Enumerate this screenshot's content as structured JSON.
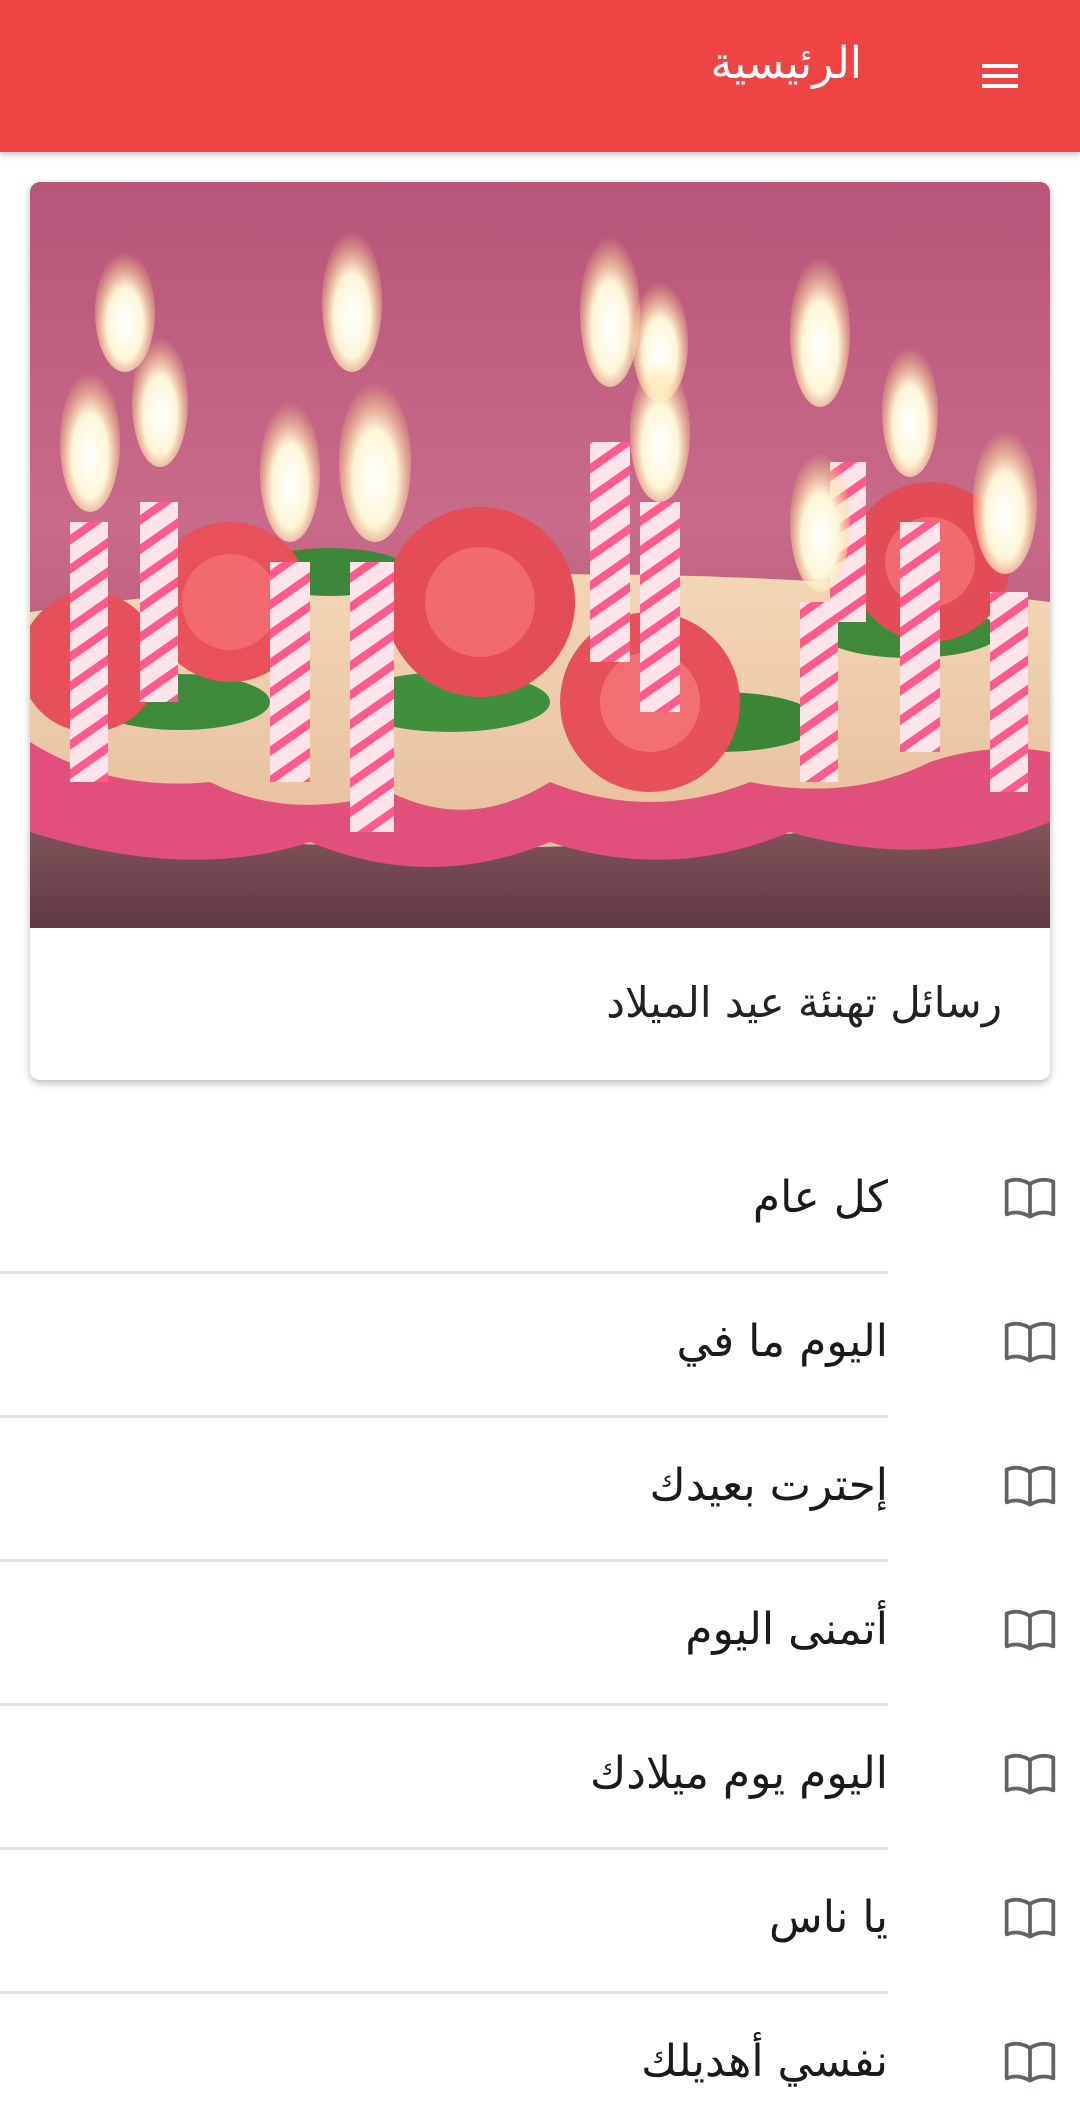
{
  "toolbar": {
    "title": "الرئيسية",
    "menu_icon": "menu-icon",
    "background": "#ef4444"
  },
  "card": {
    "image_description_icon": "birthday-cake-image",
    "title": "رسائل تهنئة عيد الميلاد"
  },
  "list": {
    "icon": "book-icon",
    "items": [
      {
        "label": "كل عام"
      },
      {
        "label": "اليوم ما في"
      },
      {
        "label": "إحترت بعيدك"
      },
      {
        "label": "أتمنى اليوم"
      },
      {
        "label": "اليوم يوم ميلادك"
      },
      {
        "label": "يا ناس"
      },
      {
        "label": "نفسي أهديلك"
      }
    ]
  }
}
